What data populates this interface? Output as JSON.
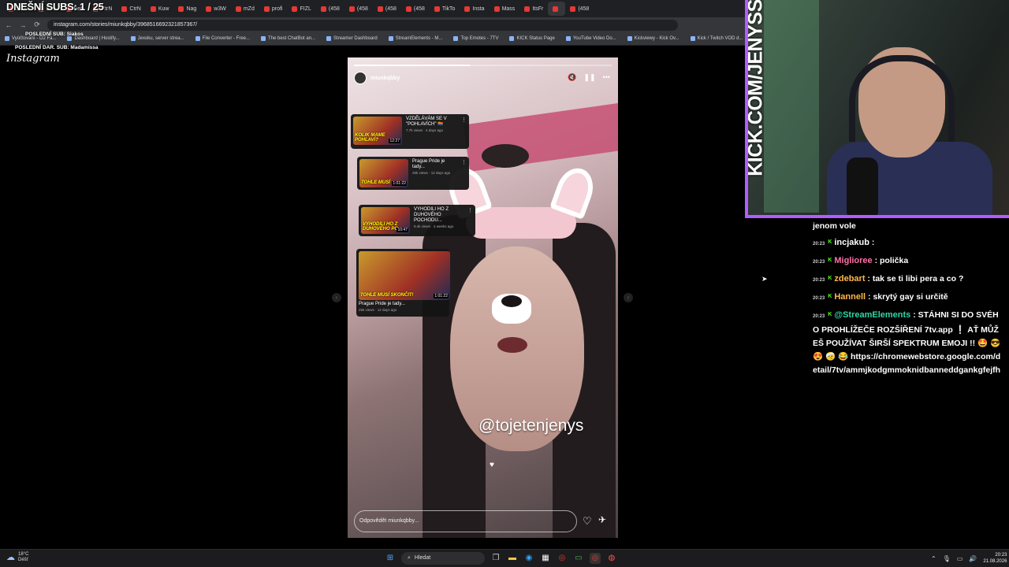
{
  "overlay": {
    "subs": "DNEŠNÍ SUBS: 1 / 25",
    "last_sub": "POSLEDNÍ SUB: Siakos",
    "last_donation": "POSLEDNÍ DAR. SUB: Madamissa"
  },
  "browser": {
    "tabs": [
      "Strea",
      "Stre",
      "Betf",
      "CtrN",
      "CtrN",
      "Kuw",
      "Nag",
      "w3W",
      "mZd",
      "profi",
      "FIZL",
      "(458",
      "(458",
      "(458",
      "(458",
      "TikTo",
      "Insta",
      "Mass",
      "ItsFr",
      "",
      "(458"
    ],
    "url": "instagram.com/stories/miunkqbby/3968516692321857367/",
    "bookmarks": [
      "Vyúčtování - O2 Fa...",
      "Dashboard | Hostify...",
      "Jexoku, server strea...",
      "File Converter - Free...",
      "The best ChatBot an...",
      "Streamer Dashboard",
      "StreamElements - M...",
      "Top Emotes - 7TV",
      "KICK Status Page",
      "YouTube Video Do...",
      "Kickviewy - Kick Ov...",
      "Kick / Twitch VOD d..."
    ]
  },
  "instagram": {
    "logo": "Instagram"
  },
  "story": {
    "username": "miunkqbby",
    "time": "9 h",
    "progress": 0.45,
    "mention": "@tojetenjenys",
    "reply_placeholder": "Odpovědět miunkqbby...",
    "cards": [
      {
        "title": "VZDĚLÁVÁM SE V \"POHLAVÍCH\" 🏳️‍🌈",
        "meta": "7.7k views · 4 days ago",
        "thumb_text": "KOLIK MAME POHLAVÍ?",
        "dur": "12:27"
      },
      {
        "title": "Prague Pride je tady...",
        "meta": "26k views · 12 days ago",
        "thumb_text": "TOHLE MUSÍ",
        "dur": "1:01:22"
      },
      {
        "title": "VYHODILI HO Z DUHOVÉHO POCHODU...",
        "meta": "9.4k views · 2 weeks ago",
        "thumb_text": "VYHODILI HO Z DUHOVÉHO PO...",
        "dur": "10:47"
      },
      {
        "title": "Prague Pride je tady...",
        "meta": "26k views · 12 days ago",
        "thumb_text": "TOHLE MUSÍ SKONČIT!",
        "dur": "1:01:22"
      }
    ]
  },
  "webcam": {
    "kick_text": "KICK.COM/JENYSS"
  },
  "chat": {
    "partial": "jenom vole",
    "messages": [
      {
        "time": "20:23",
        "user": "incjakub",
        "text": "",
        "color": "#ffffff"
      },
      {
        "time": "20:23",
        "user": "Migliorее",
        "text": "polička",
        "color": "#ff6fa8"
      },
      {
        "time": "20:23",
        "user": "zdebart",
        "text": "tak se ti libi pera a co ?",
        "color": "#ffb84d"
      },
      {
        "time": "20:23",
        "user": "Hannell",
        "text": "skrytý gay si určitě",
        "color": "#ffb84d"
      },
      {
        "time": "20:23",
        "user": "@StreamElements",
        "text": "STÁHNI SI DO SVÉHO PROHLÍŽEČE ROZŠÍŘENÍ 7tv.app ❕ AŤ MŮŽEŠ POUŽÍVAT ŠIRŠÍ SPEKTRUM EMOJI !! 🤩 😎 😍 🤕 😂 https://chromewebstore.google.com/detail/7tv/ammjkodgmmoknidbanneddgankgfejfh",
        "color": "#33d6a6"
      }
    ]
  },
  "taskbar": {
    "temp": "18°C",
    "weather": "Déšť",
    "search": "Hledat",
    "time": "20:23",
    "date": "21.08.2026"
  }
}
